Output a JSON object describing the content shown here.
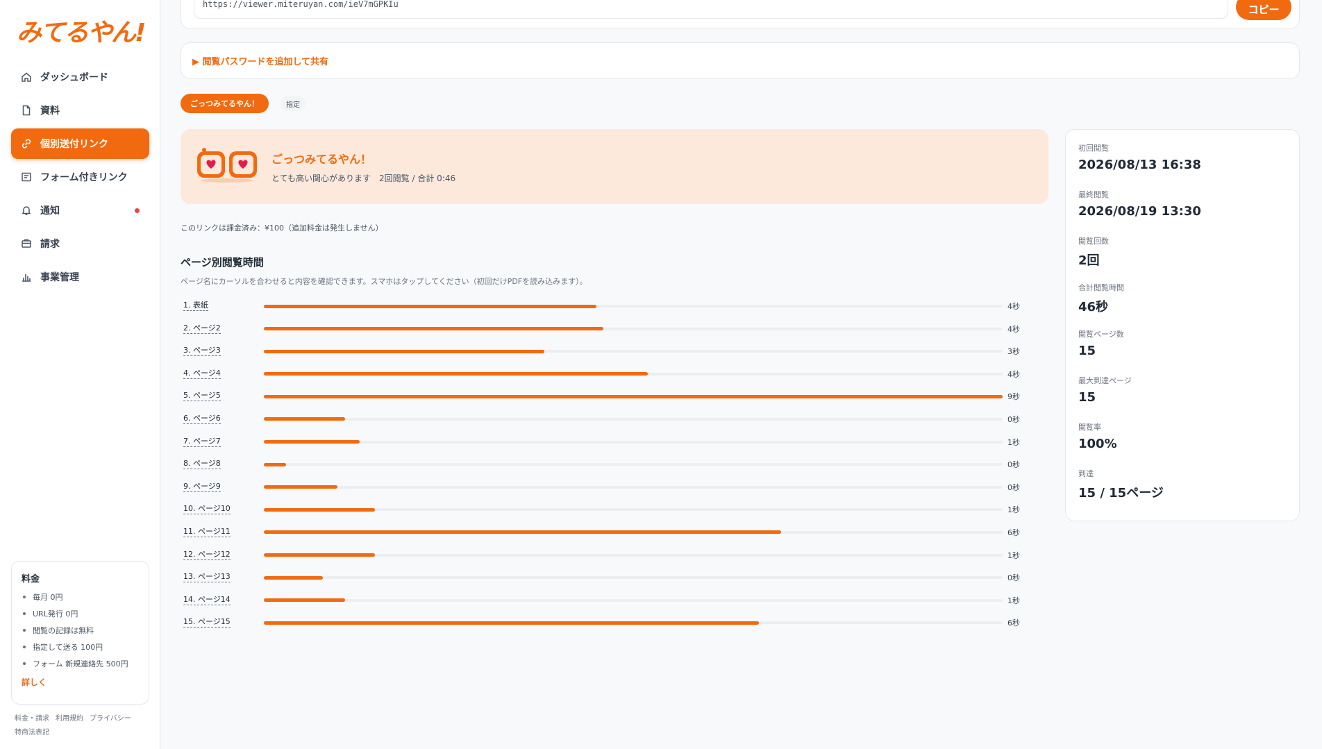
{
  "app": {
    "logo": "みてるやん!"
  },
  "sidebar": {
    "items": [
      {
        "label": "ダッシュボード",
        "icon": "home-icon"
      },
      {
        "label": "資料",
        "icon": "document-icon"
      },
      {
        "label": "個別送付リンク",
        "icon": "link-icon"
      },
      {
        "label": "フォーム付きリンク",
        "icon": "form-icon"
      },
      {
        "label": "通知",
        "icon": "bell-icon"
      },
      {
        "label": "請求",
        "icon": "billing-icon"
      },
      {
        "label": "事業管理",
        "icon": "chart-icon"
      }
    ],
    "pricing": {
      "title": "料金",
      "items": [
        "毎月 0円",
        "URL発行 0円",
        "閲覧の記録は無料",
        "指定して送る 100円",
        "フォーム 新規連絡先 500円"
      ],
      "more": "詳しく"
    },
    "footer": [
      "料金・請求",
      "利用規約",
      "プライバシー",
      "特商法表記"
    ]
  },
  "share": {
    "url": "https://viewer.miteruyan.com/ieV7mGPKIu",
    "copy_label": "コピー",
    "password_toggle": "▶ 閲覧パスワードを追加して共有"
  },
  "tags": {
    "active": "ごっつみてるやん！",
    "plain": "指定"
  },
  "hero": {
    "title": "ごっつみてるやん！",
    "interest": "とても高い関心があります",
    "summary": "2回閲覧 / 合計 0:46"
  },
  "billing_note": "このリンクは課金済み：¥100（追加料金は発生しません）",
  "page_section": {
    "title": "ページ別閲覧時間",
    "description": "ページ名にカーソルを合わせると内容を確認できます。スマホはタップしてください（初回だけPDFを読み込みます）。"
  },
  "chart_data": {
    "type": "bar",
    "orientation": "horizontal",
    "categories": [
      "1. 表紙",
      "2. ページ2",
      "3. ページ3",
      "4. ページ4",
      "5. ページ5",
      "6. ページ6",
      "7. ページ7",
      "8. ページ8",
      "9. ページ9",
      "10. ページ10",
      "11. ページ11",
      "12. ページ12",
      "13. ページ13",
      "14. ページ14",
      "15. ページ15"
    ],
    "value_labels": [
      "4秒",
      "4秒",
      "3秒",
      "4秒",
      "9秒",
      "0秒",
      "1秒",
      "0秒",
      "0秒",
      "1秒",
      "6秒",
      "1秒",
      "0秒",
      "1秒",
      "6秒"
    ],
    "fractions": [
      0.45,
      0.46,
      0.38,
      0.52,
      1.0,
      0.11,
      0.13,
      0.03,
      0.1,
      0.15,
      0.7,
      0.15,
      0.08,
      0.11,
      0.67
    ],
    "color": "#f26a10"
  },
  "stats": [
    {
      "label": "初回閲覧",
      "value": "2026/08/13 16:38"
    },
    {
      "label": "最終閲覧",
      "value": "2026/08/19 13:30"
    },
    {
      "label": "閲覧回数",
      "value": "2回"
    },
    {
      "label": "合計閲覧時間",
      "value": "46秒"
    },
    {
      "label": "閲覧ページ数",
      "value": "15"
    },
    {
      "label": "最大到達ページ",
      "value": "15"
    },
    {
      "label": "閲覧率",
      "value": "100%"
    },
    {
      "label": "到達",
      "value": "15 / 15ページ"
    }
  ],
  "colors": {
    "accent": "#f26a10",
    "hero_bg": "#fde9dc",
    "notify_dot": "#ef4444"
  }
}
